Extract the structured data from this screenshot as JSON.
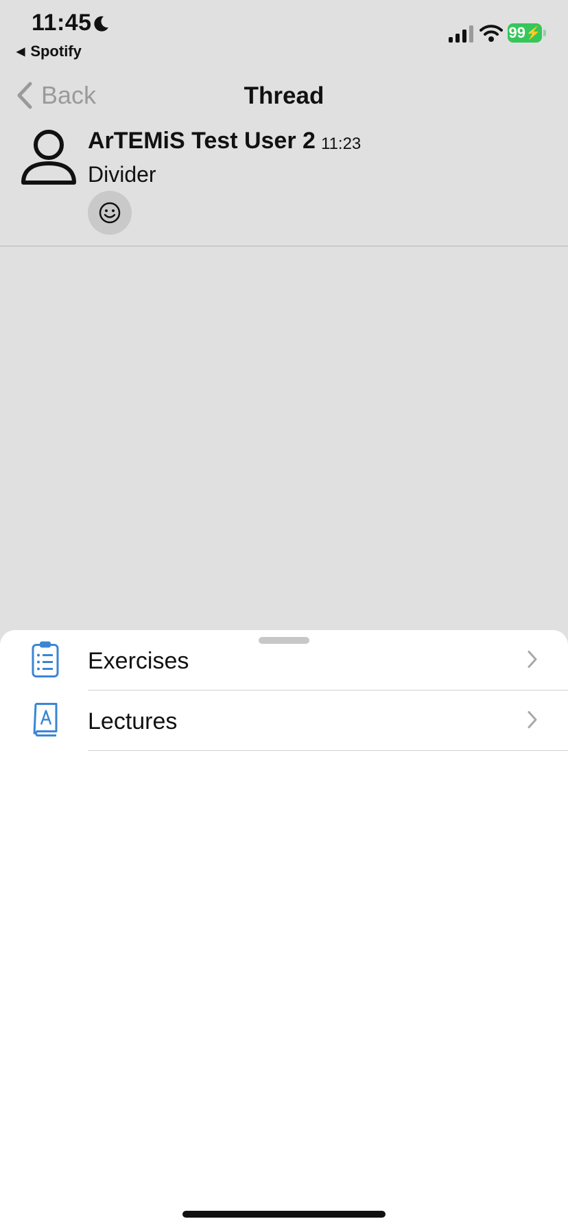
{
  "status_bar": {
    "time": "11:45",
    "back_app": "Spotify",
    "battery": "99",
    "icons": [
      "moon-icon",
      "signal-icon",
      "wifi-icon",
      "battery-charging-icon"
    ]
  },
  "nav": {
    "back_label": "Back",
    "title": "Thread"
  },
  "message": {
    "sender": "ArTEMiS Test User 2",
    "time": "11:23",
    "text": "Divider",
    "reaction_icon": "smiley-icon"
  },
  "sheet": {
    "items": [
      {
        "label": "Exercises",
        "icon": "clipboard-list-icon"
      },
      {
        "label": "Lectures",
        "icon": "book-icon"
      }
    ]
  },
  "colors": {
    "background": "#e0e0e0",
    "sheet": "#ffffff",
    "accent_icon": "#3a86d4",
    "battery": "#35c759",
    "muted": "#9a9a9a"
  }
}
